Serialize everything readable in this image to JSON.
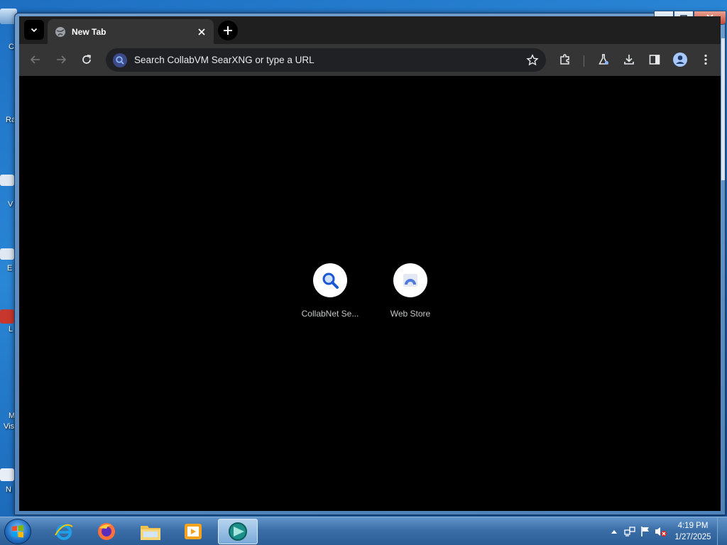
{
  "desktop": {
    "labels": [
      "C",
      "Ra",
      "V",
      "E",
      "L",
      "M",
      "Vis",
      "N"
    ]
  },
  "browser": {
    "tab": {
      "title": "New Tab"
    },
    "omnibox": {
      "placeholder": "Search CollabVM SearXNG or type a URL"
    },
    "shortcuts": [
      {
        "label": "CollabNet Se...",
        "icon": "search-icon"
      },
      {
        "label": "Web Store",
        "icon": "web-store-icon"
      }
    ],
    "colors": {
      "frame": "#1f1f1f",
      "toolbar": "#353535",
      "content": "#000000",
      "accent": "#1a73e8"
    }
  },
  "taskbar": {
    "apps": [
      "internet-explorer-icon",
      "firefox-icon",
      "file-explorer-icon",
      "media-player-icon",
      "browser-icon"
    ],
    "clock": {
      "time": "4:19 PM",
      "date": "1/27/2025"
    }
  }
}
